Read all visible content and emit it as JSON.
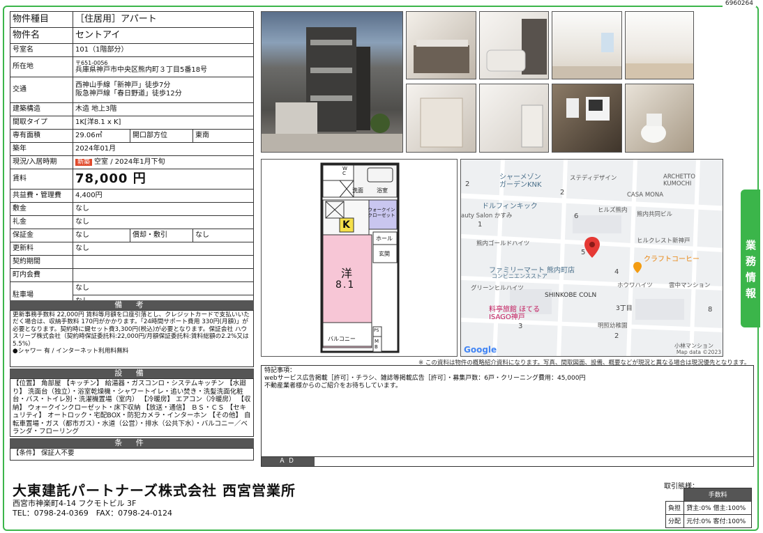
{
  "doc_id": "6960264",
  "spec": {
    "type_label": "物件種目",
    "type_value": "［住居用］アパート",
    "name_label": "物件名",
    "name_value": "セントアイ",
    "room_label": "号室名",
    "room_value": "101（1階部分）",
    "addr_label": "所在地",
    "addr_zip": "〒651-0056",
    "addr_value": "兵庫県神戸市中央区熊内町３丁目5番18号",
    "traffic_label": "交通",
    "traffic_1": "西神山手線「新神戸」徒歩7分",
    "traffic_2": "阪急神戸線「春日野道」徒歩12分",
    "struct_label": "建築構造",
    "struct_value": "木造 地上3階",
    "layout_label": "間取タイプ",
    "layout_value": "1K[洋8.1 x K]",
    "area_label": "専有面積",
    "area_value": "29.06㎡",
    "dir_label": "開口部方位",
    "dir_value": "東南",
    "built_label": "築年",
    "built_value": "2024年01月",
    "status_label": "現況/入居時期",
    "new_badge": "新築",
    "status_value": "空室 / 2024年1月下旬",
    "rent_label": "賃料",
    "rent_value": "78,000 円",
    "fee_label": "共益費・管理費",
    "fee_value": "4,400円",
    "deposit_label": "敷金",
    "deposit_value": "なし",
    "key_label": "礼金",
    "key_value": "なし",
    "guar_label": "保証金",
    "guar_value": "なし",
    "amort_label": "償却・敷引",
    "amort_value": "なし",
    "renew_label": "更新料",
    "renew_value": "なし",
    "term_label": "契約期間",
    "term_value": "",
    "assoc_label": "町内会費",
    "assoc_value": "",
    "park_label": "駐車場",
    "park_value_1": "なし",
    "park_value_2": "なし"
  },
  "notes": {
    "title": "備 考",
    "body": "更新事務手数料 22,000円 賃料等月額を口座引落とし、クレジットカードで支払いいただく場合は、収納手数料 170円がかかります。「24時間サポート費用 330円(月額)」が必要となります。契約時に鍵セット費3,300円(税込)が必要となります。保証会社 ハウスリーブ株式会社（契約時保証委託料:22,000円/月額保証委託料:賃料総額の2.2%又は5.5%）",
    "extra": "●シャワー 有 / インターネット利用料無料"
  },
  "equipment": {
    "title": "設 備",
    "body": "【位置】 角部屋 【キッチン】 給湯器・ガスコンロ・システムキッチン 【水廻り】 洗面台（独立）・浴室乾燥機・シャワートイレ・追い焚き・洗髪洗面化粧台・バス・トイレ別・洗濯機置場（室内） 【冷暖房】 エアコン（冷暖房） 【収納】 ウォークインクローゼット・床下収納 【放送・通信】 ＢＳ・ＣＳ 【セキュリティ】 オートロック・宅配BOX・防犯カメラ・インターホン 【その他】 自転車置場・ガス（都市ガス）・水道（公営）・排水（公共下水）・バルコニー／ベランダ・フローリング"
  },
  "conditions": {
    "title": "条 件",
    "body": "【条件】 保証人不要"
  },
  "floorplan": {
    "wc": "W C",
    "wash": "洗面",
    "bath": "浴室",
    "closet": "ウォークイン クローゼット",
    "k": "K",
    "hall": "ホール",
    "entrance": "玄関",
    "room": "洋",
    "room_size": "8.1",
    "balcony": "バルコニー",
    "ps": "PS",
    "mb": "M B"
  },
  "map": {
    "labels": [
      "シャーメゾン ガーデンKNK",
      "ステディデザイン",
      "ARCHETTO KUMOCHI",
      "CASA MONA",
      "ドルフィンキック",
      "auty Salon かすみ",
      "ヒルズ熊内",
      "熊内共同ビル",
      "熊内ゴールドハイツ",
      "ヒルクレスト新神戸",
      "ファミリーマート 熊内町店",
      "コンビニエンスストア",
      "クラフトコーヒー",
      "グリーンヒルハイツ",
      "ホウワハイツ",
      "雲中マンション",
      "SHINKOBE COLN",
      "3丁目",
      "料亭旅館 ほてる ISAGO神戸",
      "明照幼稚園",
      "小林マンション"
    ],
    "numbers": [
      "2",
      "2",
      "1",
      "6",
      "5",
      "4",
      "3",
      "8",
      "2"
    ],
    "google": "Google",
    "credit": "Map data ©2023"
  },
  "disclaimer": "※ この資料は物件の概略紹介資料になります。写真、間取図面、設備、概要などが現況と異なる場合は現況優先となります。",
  "remarks": {
    "title": "特記事項：",
    "line1": "webサービス広告掲載［許可］・チラシ、雑誌等掲載広告［許可］・募集戸数：6戸・クリーニング費用：45,000円",
    "line2": "不動産業者様からのご紹介をお待ちしています。"
  },
  "ad_label": "ＡＤ",
  "side_tab": "業務情報",
  "company": {
    "name": "大東建託パートナーズ株式会社 西宮営業所",
    "address": "西宮市神楽町4-14 フクモトビル 3F",
    "phone": "TEL：0798-24-0369　FAX：0798-24-0124"
  },
  "deal": {
    "title": "取引態様：",
    "fee_header": "手数料",
    "row1_label": "負担",
    "row1_value": "貸主:0% 借主:100%",
    "row2_label": "分配",
    "row2_value": "元付:0% 客付:100%"
  },
  "colors": {
    "accent": "#3bb54a",
    "header_gray": "#555555",
    "pin": "#e53935",
    "coffee": "#f39c12"
  }
}
